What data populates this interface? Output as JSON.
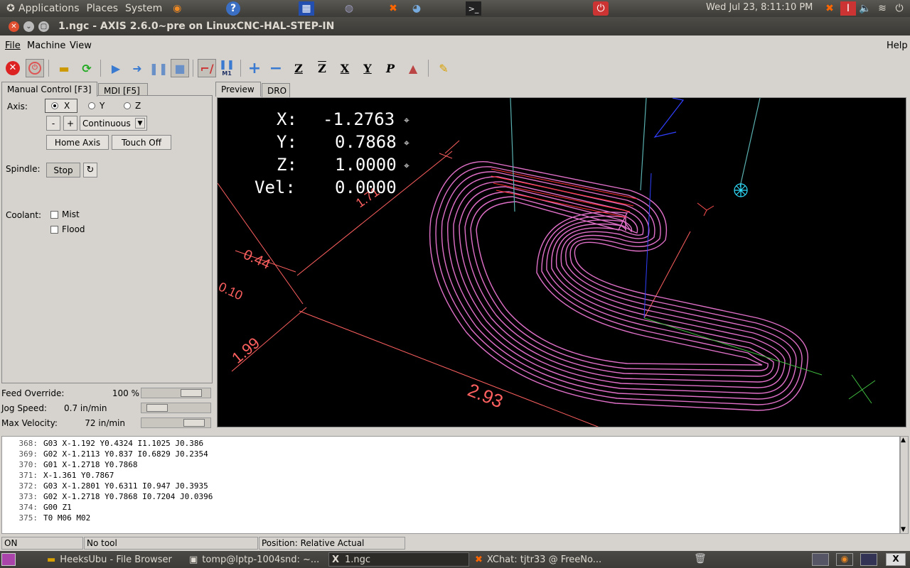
{
  "top_panel": {
    "menus": [
      "Applications",
      "Places",
      "System"
    ],
    "clock": "Wed Jul 23,  8:11:10 PM"
  },
  "window": {
    "title": "1.ngc - AXIS 2.6.0~pre on LinuxCNC-HAL-STEP-IN"
  },
  "menubar": {
    "file": "File",
    "machine": "Machine",
    "view": "View",
    "help": "Help"
  },
  "toolbar": {
    "icons": [
      "estop-icon",
      "power-icon",
      "open-file-icon",
      "reload-icon",
      "run-icon",
      "step-icon",
      "pause-icon",
      "stop-icon",
      "block-delete-icon",
      "optional-stop-icon",
      "zoom-in-icon",
      "zoom-out-icon",
      "view-z-icon",
      "view-z2-icon",
      "view-x-icon",
      "view-y-icon",
      "view-p-icon",
      "rotate-view-icon",
      "clear-plot-icon"
    ],
    "labels": {
      "m1": "M1",
      "z": "Z",
      "z2": "Z",
      "x": "X",
      "y": "Y",
      "p": "P"
    }
  },
  "left_tabs": [
    "Manual Control [F3]",
    "MDI [F5]"
  ],
  "manual": {
    "axis_label": "Axis:",
    "axis_options": [
      "X",
      "Y",
      "Z"
    ],
    "axis_selected": "X",
    "jog_minus": "-",
    "jog_plus": "+",
    "jog_mode": "Continuous",
    "home_axis": "Home Axis",
    "touch_off": "Touch Off",
    "spindle_label": "Spindle:",
    "spindle_stop": "Stop",
    "coolant_label": "Coolant:",
    "mist": "Mist",
    "flood": "Flood"
  },
  "sliders": [
    {
      "label": "Feed Override:",
      "value": "100 %",
      "level": 0.85
    },
    {
      "label": "Jog Speed:",
      "value": "0.7 in/min",
      "level": 0.1
    },
    {
      "label": "Max Velocity:",
      "value": "72 in/min",
      "level": 0.9
    }
  ],
  "preview_tabs": [
    "Preview",
    "DRO"
  ],
  "dro": [
    {
      "axis": "X:",
      "value": "-1.2763"
    },
    {
      "axis": "Y:",
      "value": "0.7868"
    },
    {
      "axis": "Z:",
      "value": "1.0000"
    },
    {
      "axis": "Vel:",
      "value": "0.0000"
    }
  ],
  "dimensions": {
    "d1": "1.71",
    "d2": "0.44",
    "d3": "0.10",
    "d4": "1.99",
    "d5": "2.93"
  },
  "axis_letters": {
    "x": "X",
    "y": "Y",
    "z": "Z"
  },
  "colors": {
    "toolpath": "#e070c8",
    "feed": "#ff3030",
    "grid": "#ff6060"
  },
  "code_lines": [
    {
      "n": "368:",
      "text": "G03 X-1.192 Y0.4324 I1.1025 J0.386"
    },
    {
      "n": "369:",
      "text": "G02 X-1.2113 Y0.837 I0.6829 J0.2354"
    },
    {
      "n": "370:",
      "text": "G01 X-1.2718 Y0.7868"
    },
    {
      "n": "371:",
      "text": "X-1.361 Y0.7867"
    },
    {
      "n": "372:",
      "text": "G03 X-1.2801 Y0.6311 I0.947 J0.3935"
    },
    {
      "n": "373:",
      "text": "G02 X-1.2718 Y0.7868 I0.7204 J0.0396"
    },
    {
      "n": "374:",
      "text": "G00 Z1"
    },
    {
      "n": "375:",
      "text": "T0 M06 M02"
    }
  ],
  "status": {
    "state": "ON",
    "tool": "No tool",
    "position": "Position: Relative Actual"
  },
  "taskbar": [
    "HeeksUbu - File Browser",
    "tomp@lptp-1004snd: ~...",
    "1.ngc",
    "XChat: tjtr33 @ FreeNo..."
  ]
}
